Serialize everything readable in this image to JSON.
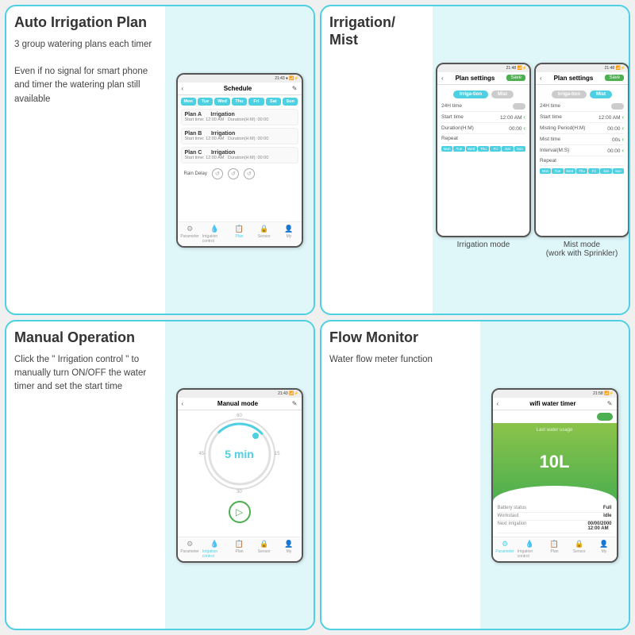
{
  "q1": {
    "title": "Auto Irrigation Plan",
    "desc_lines": [
      "3 group watering plans each timer",
      "",
      "Even if no signal for smart phone and timer the watering plan still available"
    ],
    "phone": {
      "status": "21:43 ♦ 📶▼⚡",
      "header_title": "Schedule",
      "days": [
        "Mon",
        "Tue",
        "Wed",
        "Thu",
        "Fri",
        "Sat",
        "Sun"
      ],
      "plans": [
        {
          "name": "Plan A",
          "type": "Irrigation",
          "start": "Start time: 12:00 AM",
          "duration": "Duration(H:M): 00:00"
        },
        {
          "name": "Plan B",
          "type": "Irrigation",
          "start": "Start time: 12:00 AM",
          "duration": "Duration(H:M): 00:00"
        },
        {
          "name": "Plan C",
          "type": "Irrigation",
          "start": "Start time: 12:00 AM",
          "duration": "Duration(H:M): 00:00"
        }
      ],
      "rain_delay": "Rain Delay",
      "nav": [
        "Parameter",
        "Irrigation control",
        "Plan",
        "Sensor",
        "My"
      ]
    }
  },
  "q2": {
    "title": "Irrigation/ Mist",
    "phone_irrigation": {
      "status": "21:48 ♦ 📶▼⚡",
      "header_title": "Plan settings",
      "mode_active": "Irriga- tion",
      "mode_inactive": "Mist",
      "save": "Save",
      "settings": [
        {
          "label": "24H time",
          "value": "Off",
          "arrow": false,
          "toggle": true
        },
        {
          "label": "Start time",
          "value": "12:00 AM",
          "arrow": true
        },
        {
          "label": "Duration(H:M)",
          "value": "00:00",
          "arrow": true
        },
        {
          "label": "Repeat",
          "value": "",
          "arrow": false
        }
      ],
      "days": [
        "Mon",
        "Tue",
        "Wed",
        "Thu",
        "Fri",
        "Sat",
        "Sun"
      ],
      "label": "Irrigation mode"
    },
    "phone_mist": {
      "status": "21:48 ♦ 📶▼⚡",
      "header_title": "Plan settings",
      "mode_active": "Irriga- tion",
      "mode_inactive": "Mist",
      "save": "Save",
      "settings": [
        {
          "label": "24H time",
          "value": "Off",
          "arrow": false,
          "toggle": true
        },
        {
          "label": "Start time",
          "value": "12:00 AM",
          "arrow": true
        },
        {
          "label": "Misting Period(H:M)",
          "value": "00:00",
          "arrow": true
        },
        {
          "label": "Mist time",
          "value": "00s",
          "arrow": true
        },
        {
          "label": "Interval(M:S)",
          "value": "00:00",
          "arrow": true
        },
        {
          "label": "Repeat",
          "value": "",
          "arrow": false
        }
      ],
      "days": [
        "Mon",
        "Tue",
        "Wed",
        "Thu",
        "Fri",
        "Sat",
        "Sun"
      ],
      "label": "Mist mode\n(work with Sprinkler)"
    }
  },
  "q3": {
    "title": "Manual Operation",
    "desc_lines": [
      "Click the \" Irrigation control \" to manually turn ON/OFF the water timer and set the start time"
    ],
    "phone": {
      "status": "21:43 ♦ 📶▼⚡",
      "header_title": "Manual mode",
      "dial_value": "5 min",
      "dial_60": "60",
      "dial_15": "15",
      "dial_30": "30",
      "dial_45": "45 ·",
      "nav": [
        "Parameter",
        "Irrigation control",
        "Plan",
        "Sensor",
        "My"
      ],
      "active_nav": 1
    }
  },
  "q4": {
    "title": "Flow Monitor",
    "desc": "Water flow meter function",
    "phone": {
      "status": "21:58 ♦ 📶▼⚡",
      "header_title": "wifi water timer",
      "last_water": "Last water usage",
      "flow_value": "10L",
      "stats": [
        {
          "key": "Battery status",
          "val": "Full"
        },
        {
          "key": "Workstaut",
          "val": "Idle"
        },
        {
          "key": "Next irrigation",
          "val": "00/00/2000\n12:00 AM"
        }
      ],
      "nav": [
        "Parameter",
        "Irrigation control",
        "Plan",
        "Sensor",
        "My"
      ],
      "active_nav": 0
    }
  }
}
